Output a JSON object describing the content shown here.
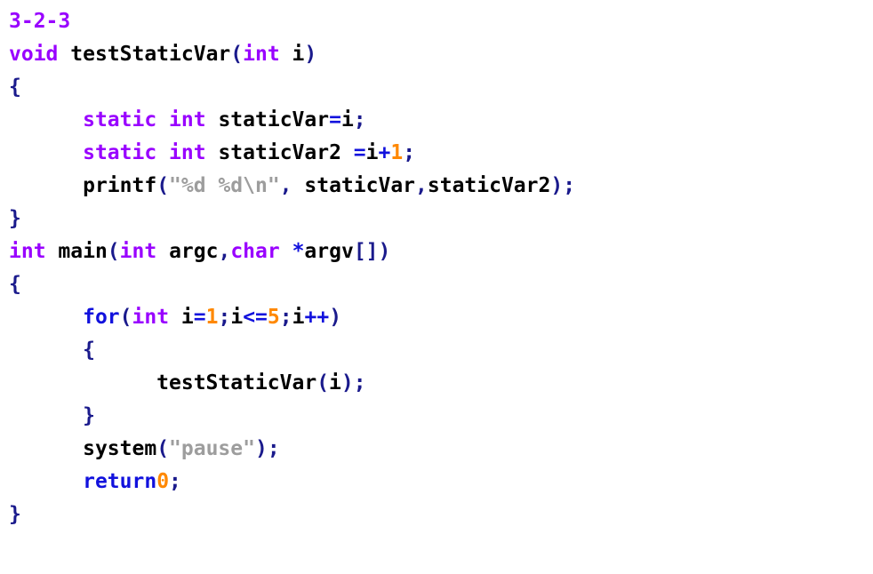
{
  "document": {
    "kind": "source-code-listing",
    "language": "C",
    "header_label": "3-2-3",
    "background_color": "#ffffff",
    "palette": {
      "type_keyword": "#9900ff",
      "control_keyword": "#1111dd",
      "operator": "#1111dd",
      "punctuation": "#1a1a8c",
      "brace": "#1a1a8c",
      "number_literal": "#ff8800",
      "string_literal": "#9d9d9d",
      "identifier": "#000000",
      "header": "#9900ff"
    }
  },
  "code": {
    "plain_text": "3-2-3\nvoid testStaticVar(int i)\n{\n      static int staticVar=i;\n      static int staticVar2 =i+1;\n      printf(\"%d %d\\n\", staticVar,staticVar2);\n}\nint main(int argc,char *argv[])\n{\n      for(int i=1;i<=5;i++)\n      {\n            testStaticVar(i);\n      }\n      system(\"pause\");\n      return0;\n}",
    "lines": [
      {
        "id": "line-header",
        "indent": 0,
        "tokens": [
          {
            "text": "3-2-3",
            "kind": "head"
          }
        ]
      },
      {
        "id": "line-func-signature",
        "indent": 0,
        "tokens": [
          {
            "text": "void",
            "kind": "type"
          },
          {
            "text": " ",
            "kind": "plain"
          },
          {
            "text": "testStaticVar",
            "kind": "id"
          },
          {
            "text": "(",
            "kind": "punct"
          },
          {
            "text": "int",
            "kind": "type"
          },
          {
            "text": " ",
            "kind": "plain"
          },
          {
            "text": "i",
            "kind": "id"
          },
          {
            "text": ")",
            "kind": "punct"
          }
        ]
      },
      {
        "id": "line-func-open-brace",
        "indent": 0,
        "tokens": [
          {
            "text": "{",
            "kind": "brace"
          }
        ]
      },
      {
        "id": "line-static-var1",
        "indent": 6,
        "tokens": [
          {
            "text": "static",
            "kind": "type"
          },
          {
            "text": " ",
            "kind": "plain"
          },
          {
            "text": "int",
            "kind": "type"
          },
          {
            "text": " ",
            "kind": "plain"
          },
          {
            "text": "staticVar",
            "kind": "id"
          },
          {
            "text": "=",
            "kind": "op"
          },
          {
            "text": "i",
            "kind": "id"
          },
          {
            "text": ";",
            "kind": "punct"
          }
        ]
      },
      {
        "id": "line-static-var2",
        "indent": 6,
        "tokens": [
          {
            "text": "static",
            "kind": "type"
          },
          {
            "text": " ",
            "kind": "plain"
          },
          {
            "text": "int",
            "kind": "type"
          },
          {
            "text": " ",
            "kind": "plain"
          },
          {
            "text": "staticVar2",
            "kind": "id"
          },
          {
            "text": " ",
            "kind": "plain"
          },
          {
            "text": "=",
            "kind": "op"
          },
          {
            "text": "i",
            "kind": "id"
          },
          {
            "text": "+",
            "kind": "op"
          },
          {
            "text": "1",
            "kind": "num"
          },
          {
            "text": ";",
            "kind": "punct"
          }
        ]
      },
      {
        "id": "line-printf",
        "indent": 6,
        "tokens": [
          {
            "text": "printf",
            "kind": "id"
          },
          {
            "text": "(",
            "kind": "punct"
          },
          {
            "text": "\"%d %d\\n\"",
            "kind": "str"
          },
          {
            "text": ",",
            "kind": "punct"
          },
          {
            "text": " ",
            "kind": "plain"
          },
          {
            "text": "staticVar",
            "kind": "id"
          },
          {
            "text": ",",
            "kind": "punct"
          },
          {
            "text": "staticVar2",
            "kind": "id"
          },
          {
            "text": ")",
            "kind": "punct"
          },
          {
            "text": ";",
            "kind": "punct"
          }
        ]
      },
      {
        "id": "line-func-close-brace",
        "indent": 0,
        "tokens": [
          {
            "text": "}",
            "kind": "brace"
          }
        ]
      },
      {
        "id": "line-main-signature",
        "indent": 0,
        "tokens": [
          {
            "text": "int",
            "kind": "type"
          },
          {
            "text": " ",
            "kind": "plain"
          },
          {
            "text": "main",
            "kind": "id"
          },
          {
            "text": "(",
            "kind": "punct"
          },
          {
            "text": "int",
            "kind": "type"
          },
          {
            "text": " ",
            "kind": "plain"
          },
          {
            "text": "argc",
            "kind": "id"
          },
          {
            "text": ",",
            "kind": "punct"
          },
          {
            "text": "char",
            "kind": "type"
          },
          {
            "text": " ",
            "kind": "plain"
          },
          {
            "text": "*",
            "kind": "op"
          },
          {
            "text": "argv",
            "kind": "id"
          },
          {
            "text": "[]",
            "kind": "punct"
          },
          {
            "text": ")",
            "kind": "punct"
          }
        ]
      },
      {
        "id": "line-main-open-brace",
        "indent": 0,
        "tokens": [
          {
            "text": "{",
            "kind": "brace"
          }
        ]
      },
      {
        "id": "line-for-loop",
        "indent": 6,
        "tokens": [
          {
            "text": "for",
            "kind": "ctrl"
          },
          {
            "text": "(",
            "kind": "punct"
          },
          {
            "text": "int",
            "kind": "type"
          },
          {
            "text": " ",
            "kind": "plain"
          },
          {
            "text": "i",
            "kind": "id"
          },
          {
            "text": "=",
            "kind": "op"
          },
          {
            "text": "1",
            "kind": "num"
          },
          {
            "text": ";",
            "kind": "punct"
          },
          {
            "text": "i",
            "kind": "id"
          },
          {
            "text": "<=",
            "kind": "op"
          },
          {
            "text": "5",
            "kind": "num"
          },
          {
            "text": ";",
            "kind": "punct"
          },
          {
            "text": "i",
            "kind": "id"
          },
          {
            "text": "++",
            "kind": "op"
          },
          {
            "text": ")",
            "kind": "punct"
          }
        ]
      },
      {
        "id": "line-for-open-brace",
        "indent": 6,
        "tokens": [
          {
            "text": "{",
            "kind": "brace"
          }
        ]
      },
      {
        "id": "line-call-teststaticvar",
        "indent": 12,
        "tokens": [
          {
            "text": "testStaticVar",
            "kind": "id"
          },
          {
            "text": "(",
            "kind": "punct"
          },
          {
            "text": "i",
            "kind": "id"
          },
          {
            "text": ")",
            "kind": "punct"
          },
          {
            "text": ";",
            "kind": "punct"
          }
        ]
      },
      {
        "id": "line-for-close-brace",
        "indent": 6,
        "tokens": [
          {
            "text": "}",
            "kind": "brace"
          }
        ]
      },
      {
        "id": "line-system-pause",
        "indent": 6,
        "tokens": [
          {
            "text": "system",
            "kind": "id"
          },
          {
            "text": "(",
            "kind": "punct"
          },
          {
            "text": "\"pause\"",
            "kind": "str"
          },
          {
            "text": ")",
            "kind": "punct"
          },
          {
            "text": ";",
            "kind": "punct"
          }
        ]
      },
      {
        "id": "line-return",
        "indent": 6,
        "tokens": [
          {
            "text": "return",
            "kind": "ctrl"
          },
          {
            "text": "0",
            "kind": "num"
          },
          {
            "text": ";",
            "kind": "punct"
          }
        ]
      },
      {
        "id": "line-main-close-brace",
        "indent": 0,
        "tokens": [
          {
            "text": "}",
            "kind": "brace"
          }
        ]
      }
    ]
  }
}
